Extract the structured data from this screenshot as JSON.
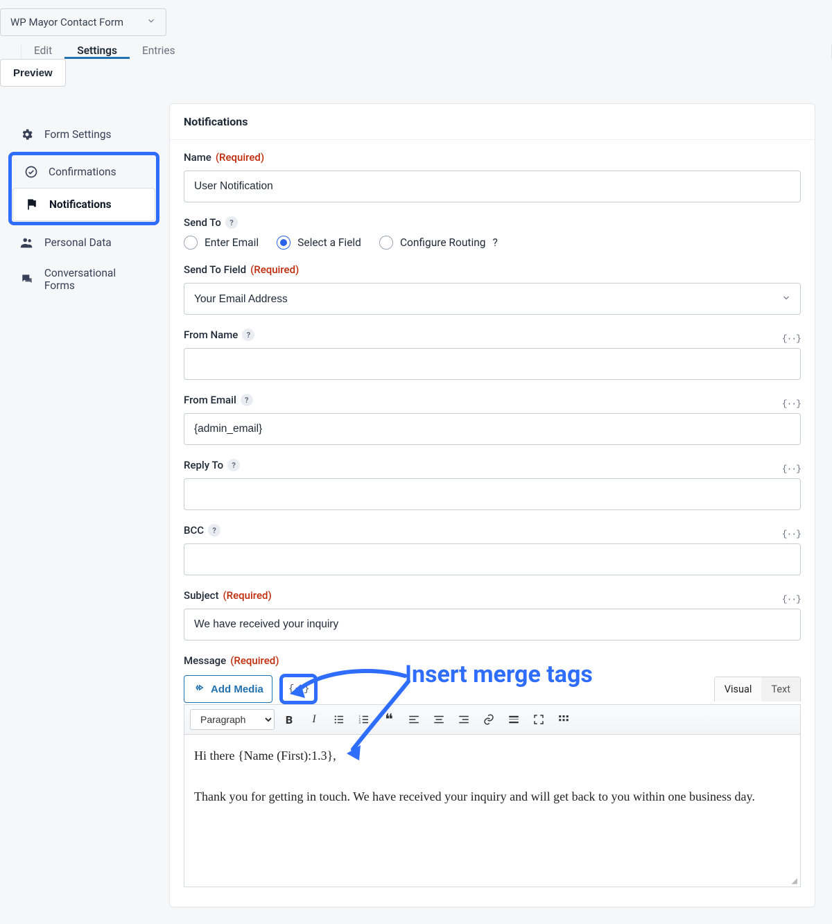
{
  "topbar": {
    "form_selector_label": "WP Mayor Contact Form",
    "tabs": {
      "edit": "Edit",
      "settings": "Settings",
      "entries": "Entries"
    },
    "preview": "Preview"
  },
  "sidebar": {
    "items": [
      {
        "label": "Form Settings",
        "icon": "gear"
      },
      {
        "label": "Confirmations",
        "icon": "check-circle"
      },
      {
        "label": "Notifications",
        "icon": "flag"
      },
      {
        "label": "Personal Data",
        "icon": "people"
      },
      {
        "label": "Conversational Forms",
        "icon": "chat"
      }
    ]
  },
  "panel": {
    "heading": "Notifications",
    "name_label": "Name",
    "required": "(Required)",
    "name_value": "User Notification",
    "send_to_label": "Send To",
    "send_to_options": {
      "enter_email": "Enter Email",
      "select_field": "Select a Field",
      "configure_routing": "Configure Routing"
    },
    "send_to_field_label": "Send To Field",
    "send_to_field_value": "Your Email Address",
    "from_name_label": "From Name",
    "from_name_value": "",
    "from_email_label": "From Email",
    "from_email_value": "{admin_email}",
    "reply_to_label": "Reply To",
    "reply_to_value": "",
    "bcc_label": "BCC",
    "bcc_value": "",
    "subject_label": "Subject",
    "subject_value": "We have received your inquiry",
    "message_label": "Message",
    "add_media": "Add Media",
    "mode_visual": "Visual",
    "mode_text": "Text",
    "format_dd": "Paragraph",
    "editor_text": "Hi there {Name (First):1.3},\n\nThank you for getting in touch. We have received your inquiry and will get back to you within one business day."
  },
  "annotation": {
    "text": "Insert merge tags"
  },
  "glyphs": {
    "merge": "{··}",
    "help": "?",
    "chevron": "⌄"
  }
}
